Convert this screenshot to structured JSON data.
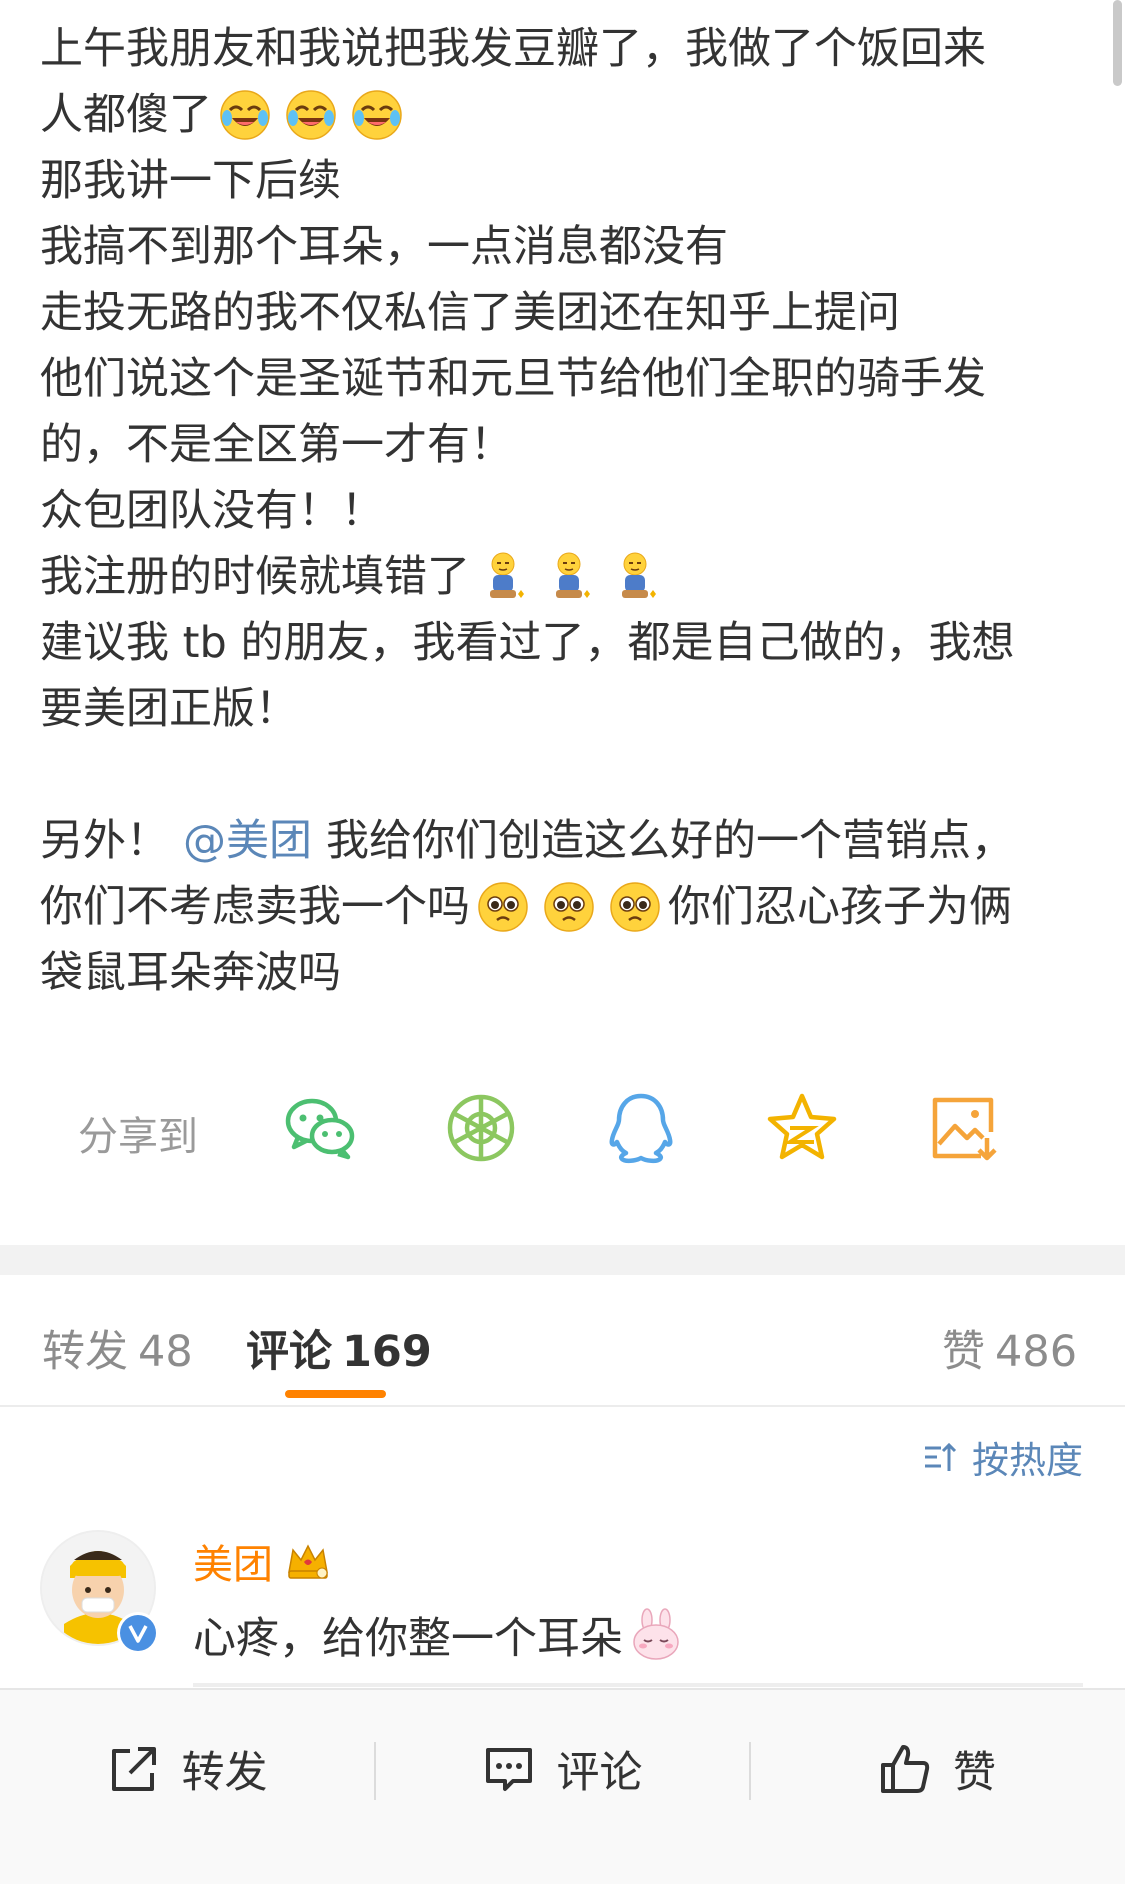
{
  "post": {
    "lines": [
      "上午我朋友和我说把我发豆瓣了，我做了个饭回来",
      "人都傻了",
      "那我讲一下后续",
      "我搞不到那个耳朵，一点消息都没有",
      "走投无路的我不仅私信了美团还在知乎上提问",
      "他们说这个是圣诞节和元旦节给他们全职的骑手发",
      "的，不是全区第一才有！",
      "众包团队没有！！",
      "我注册的时候就填错了",
      "建议我 tb 的朋友，我看过了，都是自己做的，我想",
      "要美团正版！",
      "另外！",
      "我给你们创造这么好的一个营销点，",
      "你们不考虑卖我一个吗",
      "你们忍心孩子为俩",
      "袋鼠耳朵奔波吗"
    ],
    "mention": "@美团",
    "emojis": {
      "line2": "laugh-cry-emoji",
      "line9": "kneel-emoji",
      "line14": "pleading-emoji"
    }
  },
  "share": {
    "label": "分享到",
    "targets": [
      "wechat-icon",
      "moments-icon",
      "qq-icon",
      "qzone-icon",
      "save-image-icon"
    ],
    "colors": {
      "wechat": "#4cbf71",
      "moments": "#8cc760",
      "qq": "#56a6e8",
      "qzone": "#f3b300",
      "save": "#f5a43a"
    }
  },
  "tabs": {
    "repost": {
      "label": "转发",
      "count": "48"
    },
    "comment": {
      "label": "评论",
      "count": "169"
    },
    "like": {
      "label": "赞",
      "count": "486"
    },
    "accent": "#ff8200"
  },
  "sort": {
    "label": "按热度"
  },
  "comments": [
    {
      "user": "美团",
      "text": "心疼，给你整一个耳朵"
    }
  ],
  "bottom_bar": {
    "repost": "转发",
    "comment": "评论",
    "like": "赞"
  }
}
